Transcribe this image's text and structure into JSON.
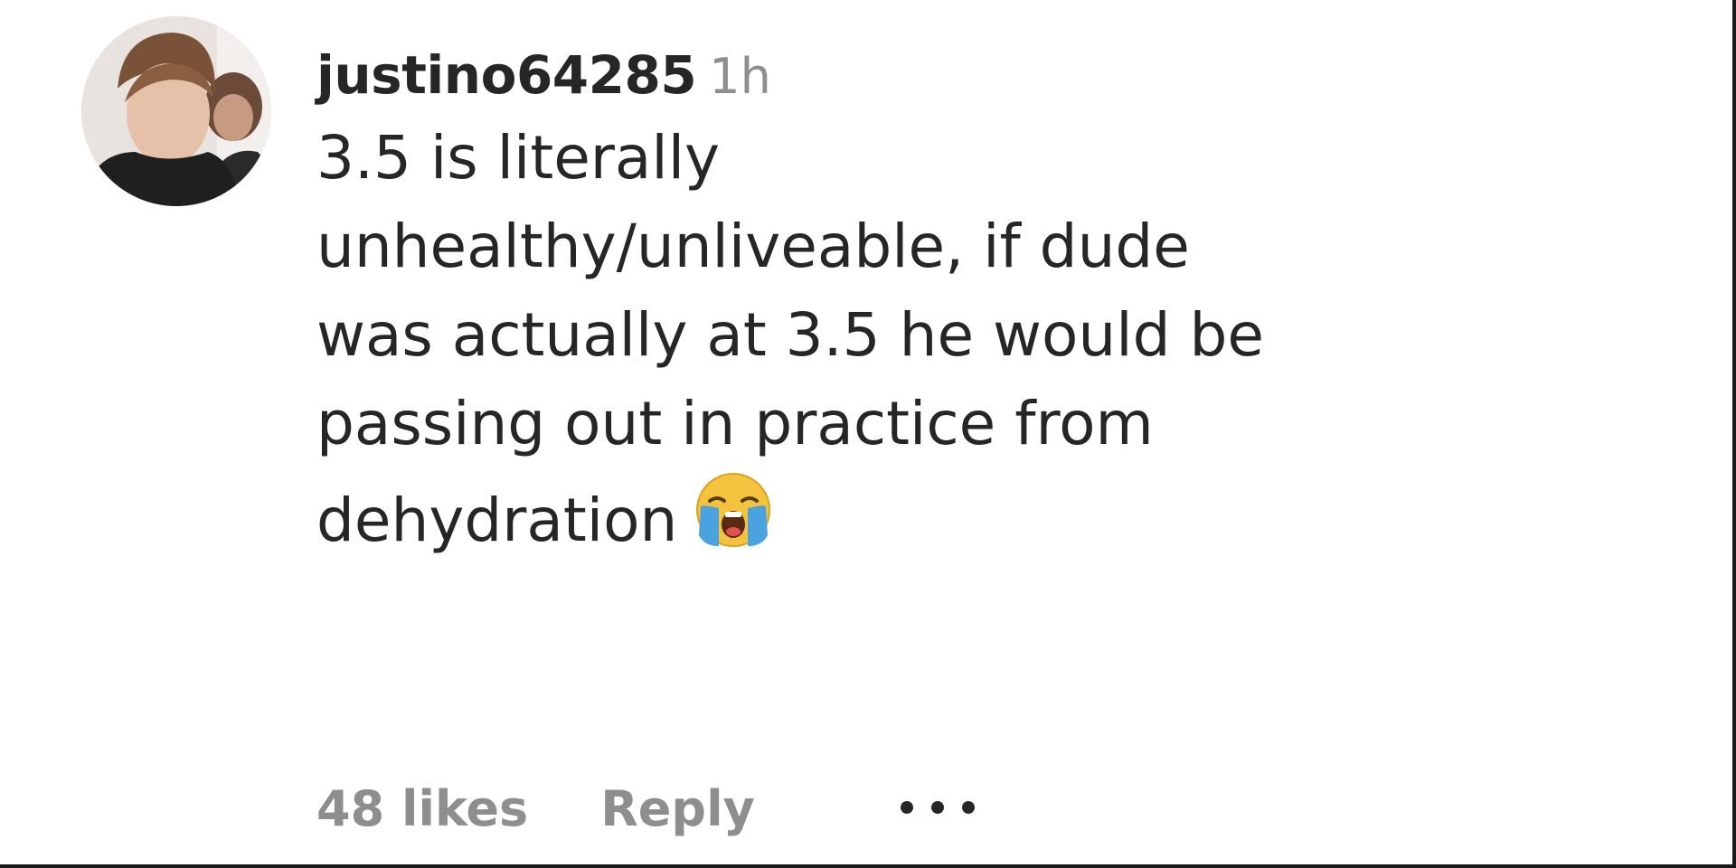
{
  "comment": {
    "username": "justino64285",
    "timestamp": "1h",
    "text_lines": [
      "3.5 is literally",
      "unhealthy/unliveable, if dude",
      "was actually at 3.5 he would be",
      "passing out in practice from",
      "dehydration"
    ],
    "emoji": "loudly-crying-face-icon",
    "likes_label": "48 likes",
    "reply_label": "Reply",
    "more_icon": "more-options-icon"
  },
  "colors": {
    "text": "#262626",
    "muted": "#8e8e8e",
    "emoji_face": "#f4c33d",
    "emoji_tears": "#4aa3df"
  }
}
